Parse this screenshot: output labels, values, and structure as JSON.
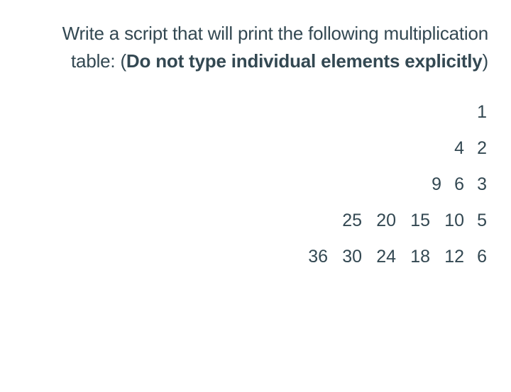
{
  "question": {
    "prefix": "Write a script that will print the following multiplication table: (",
    "bold": "Do not type individual elements explicitly",
    "suffix": ")"
  },
  "table": {
    "rows": [
      [
        "1"
      ],
      [
        "4",
        "2"
      ],
      [
        "9",
        "6",
        "3"
      ],
      [
        "25",
        "20",
        "15",
        "10",
        "5"
      ],
      [
        "36",
        "30",
        "24",
        "18",
        "12",
        "6"
      ]
    ]
  }
}
